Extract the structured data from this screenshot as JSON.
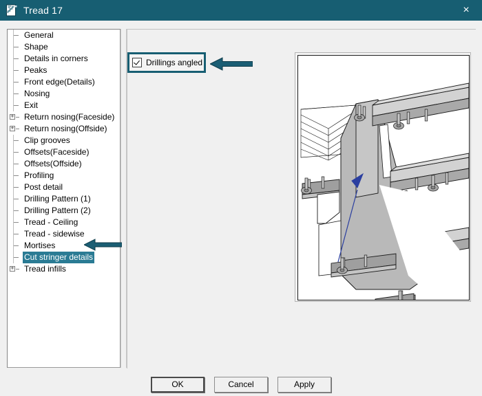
{
  "window": {
    "title": "Tread 17",
    "icon": "stair-tread-icon",
    "close_label": "×",
    "titlebar_color": "#175e72"
  },
  "tree": {
    "items": [
      {
        "label": "General",
        "expandable": false,
        "selected": false
      },
      {
        "label": "Shape",
        "expandable": false,
        "selected": false
      },
      {
        "label": "Details in corners",
        "expandable": false,
        "selected": false
      },
      {
        "label": "Peaks",
        "expandable": false,
        "selected": false
      },
      {
        "label": "Front edge(Details)",
        "expandable": false,
        "selected": false
      },
      {
        "label": "Nosing",
        "expandable": false,
        "selected": false
      },
      {
        "label": "Exit",
        "expandable": false,
        "selected": false
      },
      {
        "label": "Return nosing(Faceside)",
        "expandable": true,
        "selected": false
      },
      {
        "label": "Return nosing(Offside)",
        "expandable": true,
        "selected": false
      },
      {
        "label": "Clip grooves",
        "expandable": false,
        "selected": false
      },
      {
        "label": "Offsets(Faceside)",
        "expandable": false,
        "selected": false
      },
      {
        "label": "Offsets(Offside)",
        "expandable": false,
        "selected": false
      },
      {
        "label": "Profiling",
        "expandable": false,
        "selected": false
      },
      {
        "label": "Post detail",
        "expandable": false,
        "selected": false
      },
      {
        "label": "Drilling Pattern (1)",
        "expandable": false,
        "selected": false
      },
      {
        "label": "Drilling Pattern (2)",
        "expandable": false,
        "selected": false
      },
      {
        "label": "Tread - Ceiling",
        "expandable": false,
        "selected": false
      },
      {
        "label": "Tread - sidewise",
        "expandable": false,
        "selected": false
      },
      {
        "label": "Mortises",
        "expandable": false,
        "selected": false
      },
      {
        "label": "Cut stringer details",
        "expandable": false,
        "selected": true
      },
      {
        "label": "Tread infills",
        "expandable": true,
        "selected": false
      }
    ],
    "expand_glyph": "+",
    "selection_color": "#2a7b94"
  },
  "options": {
    "drillings_angled": {
      "label": "Drillings angled",
      "checked": true
    }
  },
  "annotations": {
    "arrow_color": "#1b5e74",
    "arrow_to_checkbox": "points-to-drillings-angled-checkbox",
    "arrow_to_tree_item": "points-to-cut-stringer-details"
  },
  "preview": {
    "description": "3D cut stringer with stair treads and angled drillings",
    "callout_arrow_color": "#2b3fa0",
    "surface_light": "#d0d0d0",
    "surface_mid": "#b9b9b9",
    "surface_dark": "#9a9a9a",
    "outline": "#1a1a1a"
  },
  "buttons": {
    "ok": "OK",
    "cancel": "Cancel",
    "apply": "Apply"
  }
}
